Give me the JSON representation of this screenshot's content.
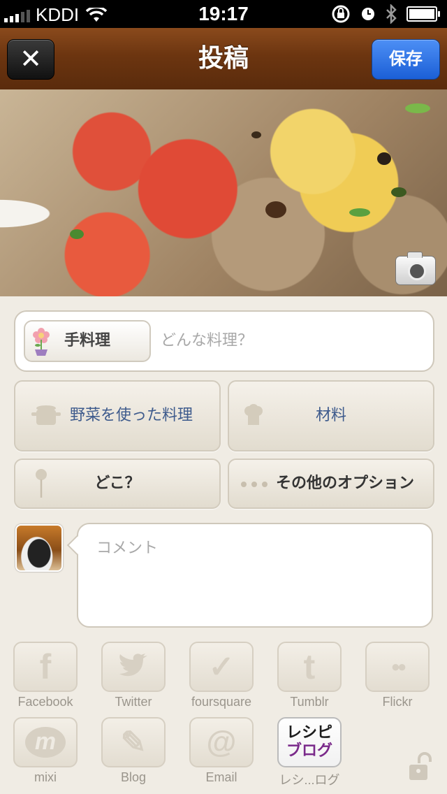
{
  "status_bar": {
    "carrier": "KDDI",
    "time": "19:17"
  },
  "nav": {
    "title": "投稿",
    "close_label": "✕",
    "save_label": "保存"
  },
  "dish": {
    "category_label": "手料理",
    "placeholder": "どんな料理？"
  },
  "options": {
    "dish_type": "野菜を使った料理",
    "ingredients": "材料",
    "location": "どこ？",
    "more": "その他のオプション"
  },
  "comment": {
    "placeholder": "コメント"
  },
  "share": [
    {
      "label": "Facebook",
      "glyph": "f"
    },
    {
      "label": "Twitter",
      "glyph": "🐦"
    },
    {
      "label": "foursquare",
      "glyph": "✓"
    },
    {
      "label": "Tumblr",
      "glyph": "t"
    },
    {
      "label": "Flickr",
      "glyph": "●●"
    },
    {
      "label": "mixi",
      "glyph": "m"
    },
    {
      "label": "Blog",
      "glyph": "✎"
    },
    {
      "label": "Email",
      "glyph": "@"
    },
    {
      "label": "レシ...ログ",
      "glyph_line1": "レシピ",
      "glyph_line2": "ブログ"
    }
  ],
  "colors": {
    "nav_wood": "#6c3510",
    "save_blue": "#1b5fd6",
    "option_text": "#3d5a8c",
    "background": "#f0ece4"
  }
}
